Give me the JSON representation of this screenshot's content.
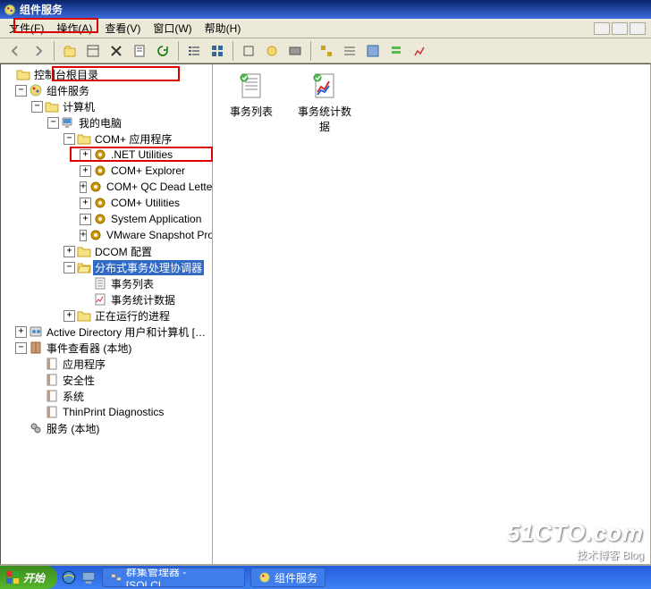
{
  "window": {
    "title": "组件服务"
  },
  "menu": {
    "file": "文件(F)",
    "action": "操作(A)",
    "view": "查看(V)",
    "window": "窗口(W)",
    "help": "帮助(H)"
  },
  "tree": {
    "root": "控制台根目录",
    "comp_services": "组件服务",
    "computers": "计算机",
    "my_computer": "我的电脑",
    "com_apps": "COM+ 应用程序",
    "net_util": ".NET Utilities",
    "com_explorer": "COM+ Explorer",
    "com_qc": "COM+ QC Dead Letter",
    "com_util": "COM+ Utilities",
    "sys_app": "System Application",
    "vmware": "VMware Snapshot Pro",
    "dcom": "DCOM 配置",
    "dtc": "分布式事务处理协调器",
    "txn_list": "事务列表",
    "txn_stats": "事务统计数据",
    "running": "正在运行的进程",
    "ad": "Active Directory 用户和计算机 […",
    "ev": "事件查看器 (本地)",
    "ev_app": "应用程序",
    "ev_sec": "安全性",
    "ev_sys": "系统",
    "ev_thin": "ThinPrint Diagnostics",
    "services": "服务 (本地)"
  },
  "content": {
    "item1": "事务列表",
    "item2": "事务统计数据"
  },
  "watermark": {
    "line1": "51CTO.com",
    "line2": "技术博客   Blog"
  },
  "taskbar": {
    "start": "开始",
    "task1": "群集管理器 - [SQLCL…",
    "task2": "组件服务"
  }
}
